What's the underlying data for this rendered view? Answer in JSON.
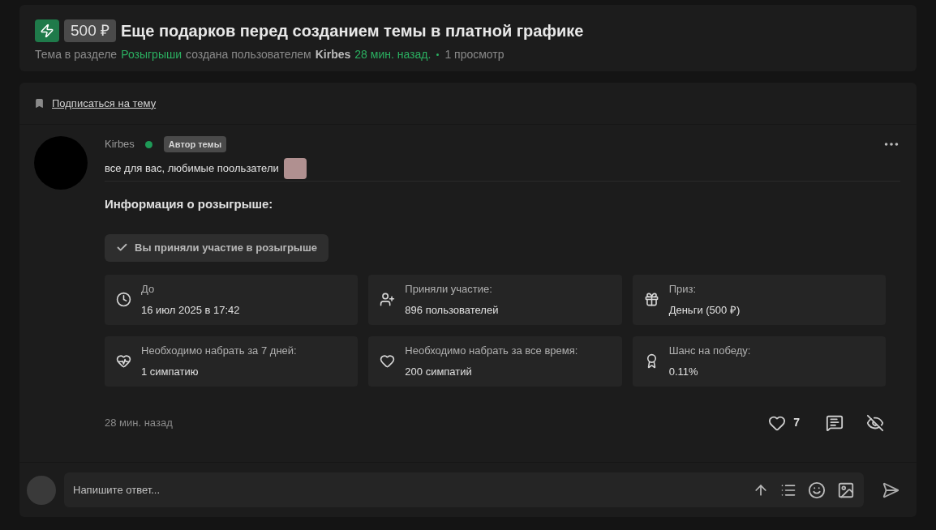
{
  "header": {
    "price": "500 ₽",
    "title": "Еще подарков перед созданием темы в платной графике",
    "meta": {
      "prefix": "Тема в разделе",
      "section": "Розыгрыши",
      "middle": "создана пользователем",
      "author": "Kirbes",
      "time": "28 мин. назад.",
      "views": "1 просмотр"
    }
  },
  "subscribe": "Подписаться на тему",
  "post": {
    "author": "Kirbes",
    "online": true,
    "badge": "Автор темы",
    "message": "все для вас, любимые поользатели",
    "giveaway_title": "Информация о розыгрыше:",
    "participated": "Вы приняли участие в розыгрыше",
    "info": [
      {
        "label": "До",
        "value": "16 июл 2025 в 17:42"
      },
      {
        "label": "Приняли участие:",
        "value": "896 пользователей"
      },
      {
        "label": "Приз:",
        "value": "Деньги (500 ₽)"
      },
      {
        "label": "Необходимо набрать за 7 дней:",
        "value": "1 симпатию"
      },
      {
        "label": "Необходимо набрать за все время:",
        "value": "200 симпатий"
      },
      {
        "label": "Шанс на победу:",
        "value": "0.11%"
      }
    ],
    "time": "28 мин. назад",
    "likes": "7"
  },
  "reply": {
    "placeholder": "Напишите ответ..."
  }
}
